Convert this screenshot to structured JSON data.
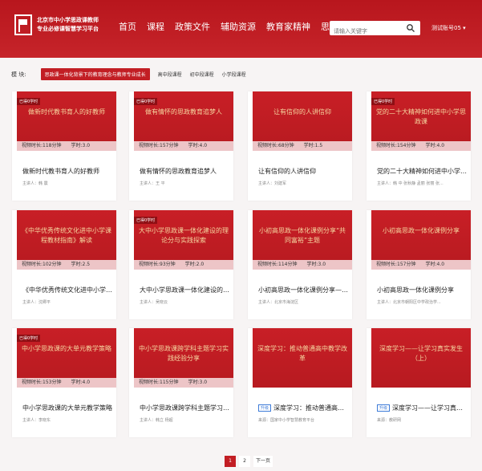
{
  "header": {
    "site_name_line1": "北京市中小学思政课教师",
    "site_name_line2": "专业必修课智慧学习平台",
    "nav": [
      "首页",
      "课程",
      "政策文件",
      "辅助资源",
      "教育家精神",
      "思政传习坊"
    ],
    "search_placeholder": "请输入关键字",
    "user": "测试账号05 ▾"
  },
  "filter": {
    "label": "模 块:",
    "chips": [
      "思政课一体化背景下的教育理念与教师专业成长",
      "高中段课程",
      "初中段课程",
      "小学段课程"
    ]
  },
  "courses": [
    {
      "thumb": "做新时代教书育人的好教师",
      "badge": "已得0学时",
      "meta": "视频时长:118分钟　　学时:3.0",
      "title": "做新时代教书育人的好教师",
      "speaker": "主讲人：韩 震",
      "tag": ""
    },
    {
      "thumb": "做有情怀的思政教育追梦人",
      "badge": "已得0学时",
      "meta": "视频时长:157分钟　　学时:4.0",
      "title": "做有情怀的思政教育追梦人",
      "speaker": "主讲人：王 平",
      "tag": ""
    },
    {
      "thumb": "让有信仰的人讲信仰",
      "badge": "",
      "meta": "视频时长:68分钟　　学时:1.5",
      "title": "让有信仰的人讲信仰",
      "speaker": "主讲人：刘建军",
      "tag": ""
    },
    {
      "thumb": "党的二十大精神如何进中小学思政课",
      "badge": "已得0学时",
      "meta": "视频时长:154分钟　　学时:4.0",
      "title": "党的二十大精神如何进中小学思...",
      "speaker": "主讲人：韩 中 张秋静 孟丽 张丽 张...",
      "tag": ""
    },
    {
      "thumb": "《中华优秀传统文化进中小学课程教材指南》解读",
      "badge": "",
      "meta": "视频时长:102分钟　　学时:2.5",
      "title": "《中华优秀传统文化进中小学课...",
      "speaker": "主讲人：沈卿平",
      "tag": ""
    },
    {
      "thumb": "大中小学思政课一体化建设的理论分与实践探索",
      "badge": "已得0学时",
      "meta": "视频时长:93分钟　　学时:2.0",
      "title": "大中小学思政课一体化建设的理...",
      "speaker": "主讲人：吴晓云",
      "tag": ""
    },
    {
      "thumb": "小初高思政一体化课例分享“共同富裕”主题",
      "badge": "",
      "meta": "视频时长:114分钟　　学时:3.0",
      "title": "小初高思政一体化课例分享——...",
      "speaker": "主讲人：北京市海淀区",
      "tag": ""
    },
    {
      "thumb": "小初高思政一体化课例分享",
      "badge": "",
      "meta": "视频时长:157分钟　　学时:4.0",
      "title": "小初高思政一体化课例分享",
      "speaker": "主讲人：北京市朝阳区中学政治学...",
      "tag": ""
    },
    {
      "thumb": "中小学思政课的大单元教学策略",
      "badge": "已得0学时",
      "meta": "视频时长:153分钟　　学时:4.0",
      "title": "中小学思政课的大单元教学策略",
      "speaker": "主讲人：李晓东",
      "tag": ""
    },
    {
      "thumb": "中小学思政课跨学科主题学习实践经验分享",
      "badge": "",
      "meta": "视频时长:115分钟　　学时:3.0",
      "title": "中小学思政课跨学科主题学习实...",
      "speaker": "主讲人：韩立 杨超",
      "tag": ""
    },
    {
      "thumb": "深度学习：推动普通高中教学改革",
      "badge": "",
      "meta": "",
      "title": "深度学习：推动普通高中...",
      "speaker": "来源：国家中小学智慧教育平台",
      "tag": "升级"
    },
    {
      "thumb": "深度学习——让学习真实发生（上）",
      "badge": "",
      "meta": "",
      "title": "深度学习——让学习真实...",
      "speaker": "来源：教研网",
      "tag": "升级"
    }
  ],
  "pagination": {
    "pages": [
      "1",
      "2"
    ],
    "next": "下一页"
  },
  "colors": {
    "brand_red": "#c21e24",
    "tag_blue": "#3d7bd8"
  }
}
